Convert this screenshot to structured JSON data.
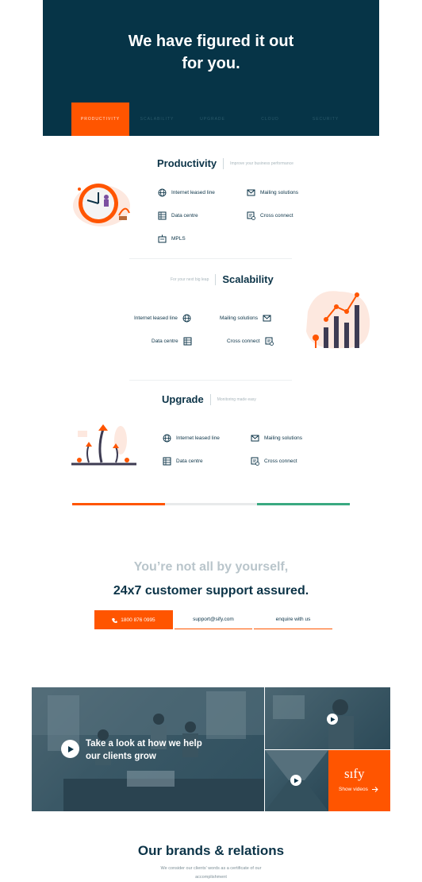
{
  "hero": {
    "title_line1": "We have figured it out",
    "title_line2": "for you.",
    "tabs": [
      {
        "label": "PRODUCTIVITY",
        "active": true
      },
      {
        "label": "SCALABILITY",
        "active": false
      },
      {
        "label": "UPGRADE",
        "active": false
      },
      {
        "label": "CLOUD",
        "active": false
      },
      {
        "label": "SECURITY",
        "active": false
      }
    ]
  },
  "productivity": {
    "title": "Productivity",
    "subtitle": "Improve your business performance",
    "services": [
      "Internet leased line",
      "Mailing solutions",
      "Data centre",
      "Cross connect",
      "MPLS"
    ]
  },
  "scalability": {
    "title": "Scalability",
    "subtitle": "For your next big leap",
    "services": [
      "Internet leased line",
      "Mailing solutions",
      "Data centre",
      "Cross connect"
    ]
  },
  "upgrade": {
    "title": "Upgrade",
    "subtitle": "Monitoring made easy",
    "services": [
      "Internet leased line",
      "Mailing solutions",
      "Data centre",
      "Cross connect"
    ]
  },
  "support": {
    "line1": "You’re not all by yourself,",
    "line2": "24x7 customer support assured.",
    "phone": "1800 876 0995",
    "email": "support@sify.com",
    "enquire": "enquire with us"
  },
  "video": {
    "headline_line1": "Take a look at how we help",
    "headline_line2": "our clients grow",
    "logo": "sıfy",
    "cta": "Show videos"
  },
  "brands": {
    "title": "Our brands & relations",
    "subtitle_line1": "We consider our clients' words as a certificate of our",
    "subtitle_line2": "accomplishment"
  },
  "colors": {
    "brand_orange": "#ff5500",
    "navy": "#063447",
    "green": "#3aa981"
  }
}
